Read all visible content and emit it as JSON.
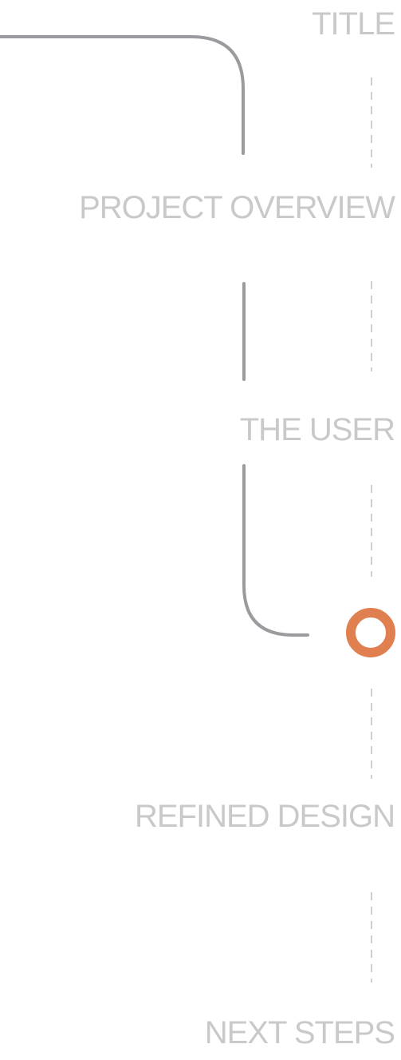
{
  "nav": {
    "items": [
      {
        "label": "TITLE"
      },
      {
        "label": "PROJECT OVERVIEW"
      },
      {
        "label": "THE USER"
      },
      {
        "label": "REFINED DESIGN"
      },
      {
        "label": "NEXT STEPS"
      }
    ],
    "current_index": 3
  },
  "colors": {
    "label": "#c9c9c9",
    "path_line": "#9b9b9f",
    "dashed_line": "#cfcfcf",
    "marker": "#e07f4f"
  }
}
